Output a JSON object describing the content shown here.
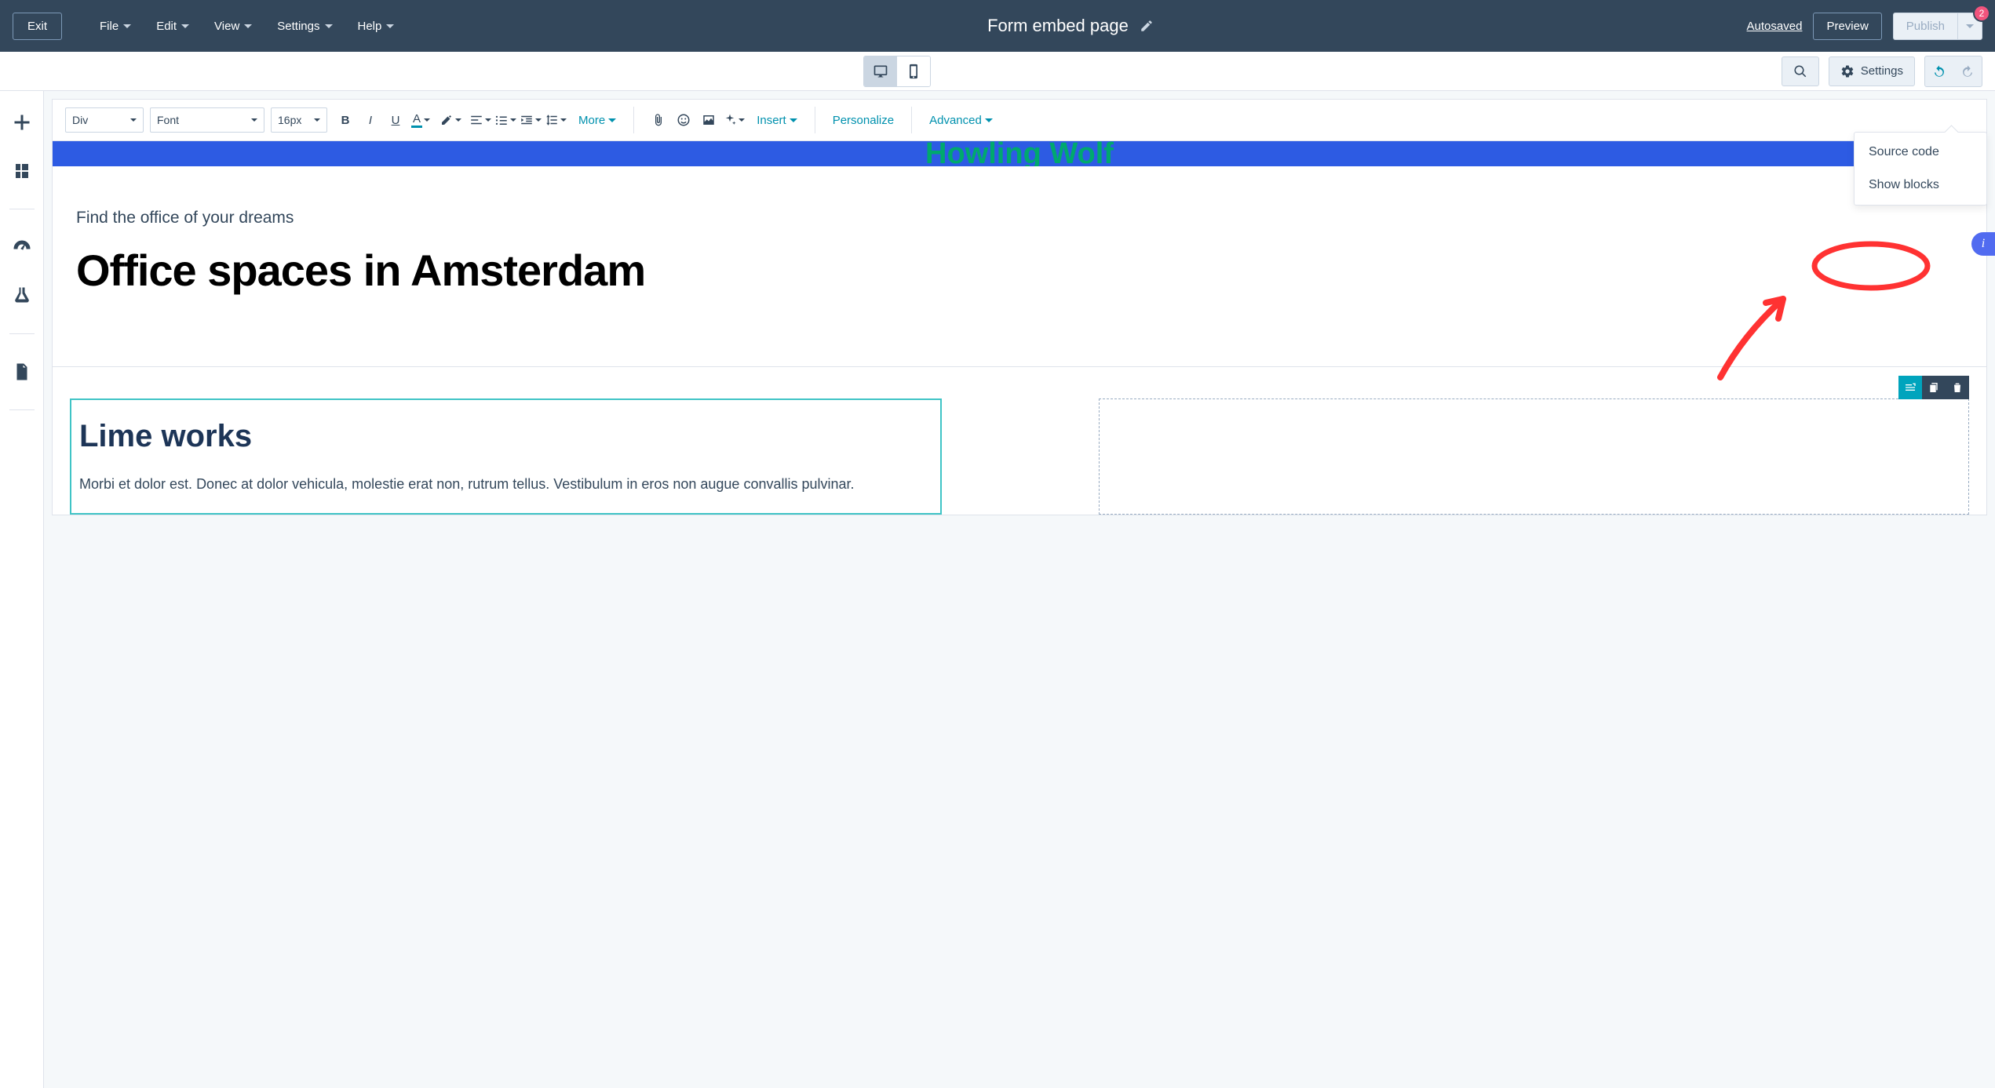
{
  "header": {
    "exit": "Exit",
    "menu": [
      "File",
      "Edit",
      "View",
      "Settings",
      "Help"
    ],
    "page_title": "Form embed page",
    "autosaved": "Autosaved",
    "preview": "Preview",
    "publish": "Publish",
    "publish_badge": "2"
  },
  "subbar": {
    "settings": "Settings"
  },
  "format": {
    "element_select": "Div",
    "font_select": "Font",
    "size_select": "16px",
    "more": "More",
    "insert": "Insert",
    "personalize": "Personalize",
    "advanced": "Advanced"
  },
  "advanced_menu": {
    "source_code": "Source code",
    "show_blocks": "Show blocks"
  },
  "canvas": {
    "hero_banner": "Howling Wolf",
    "tagline": "Find the office of your dreams",
    "heading": "Office spaces in Amsterdam",
    "col_left_heading": "Lime works",
    "col_left_body": "Morbi et dolor est. Donec at dolor vehicula, molestie erat non, rutrum tellus. Vestibulum in eros non augue convallis pulvinar."
  },
  "info_badge": "i"
}
